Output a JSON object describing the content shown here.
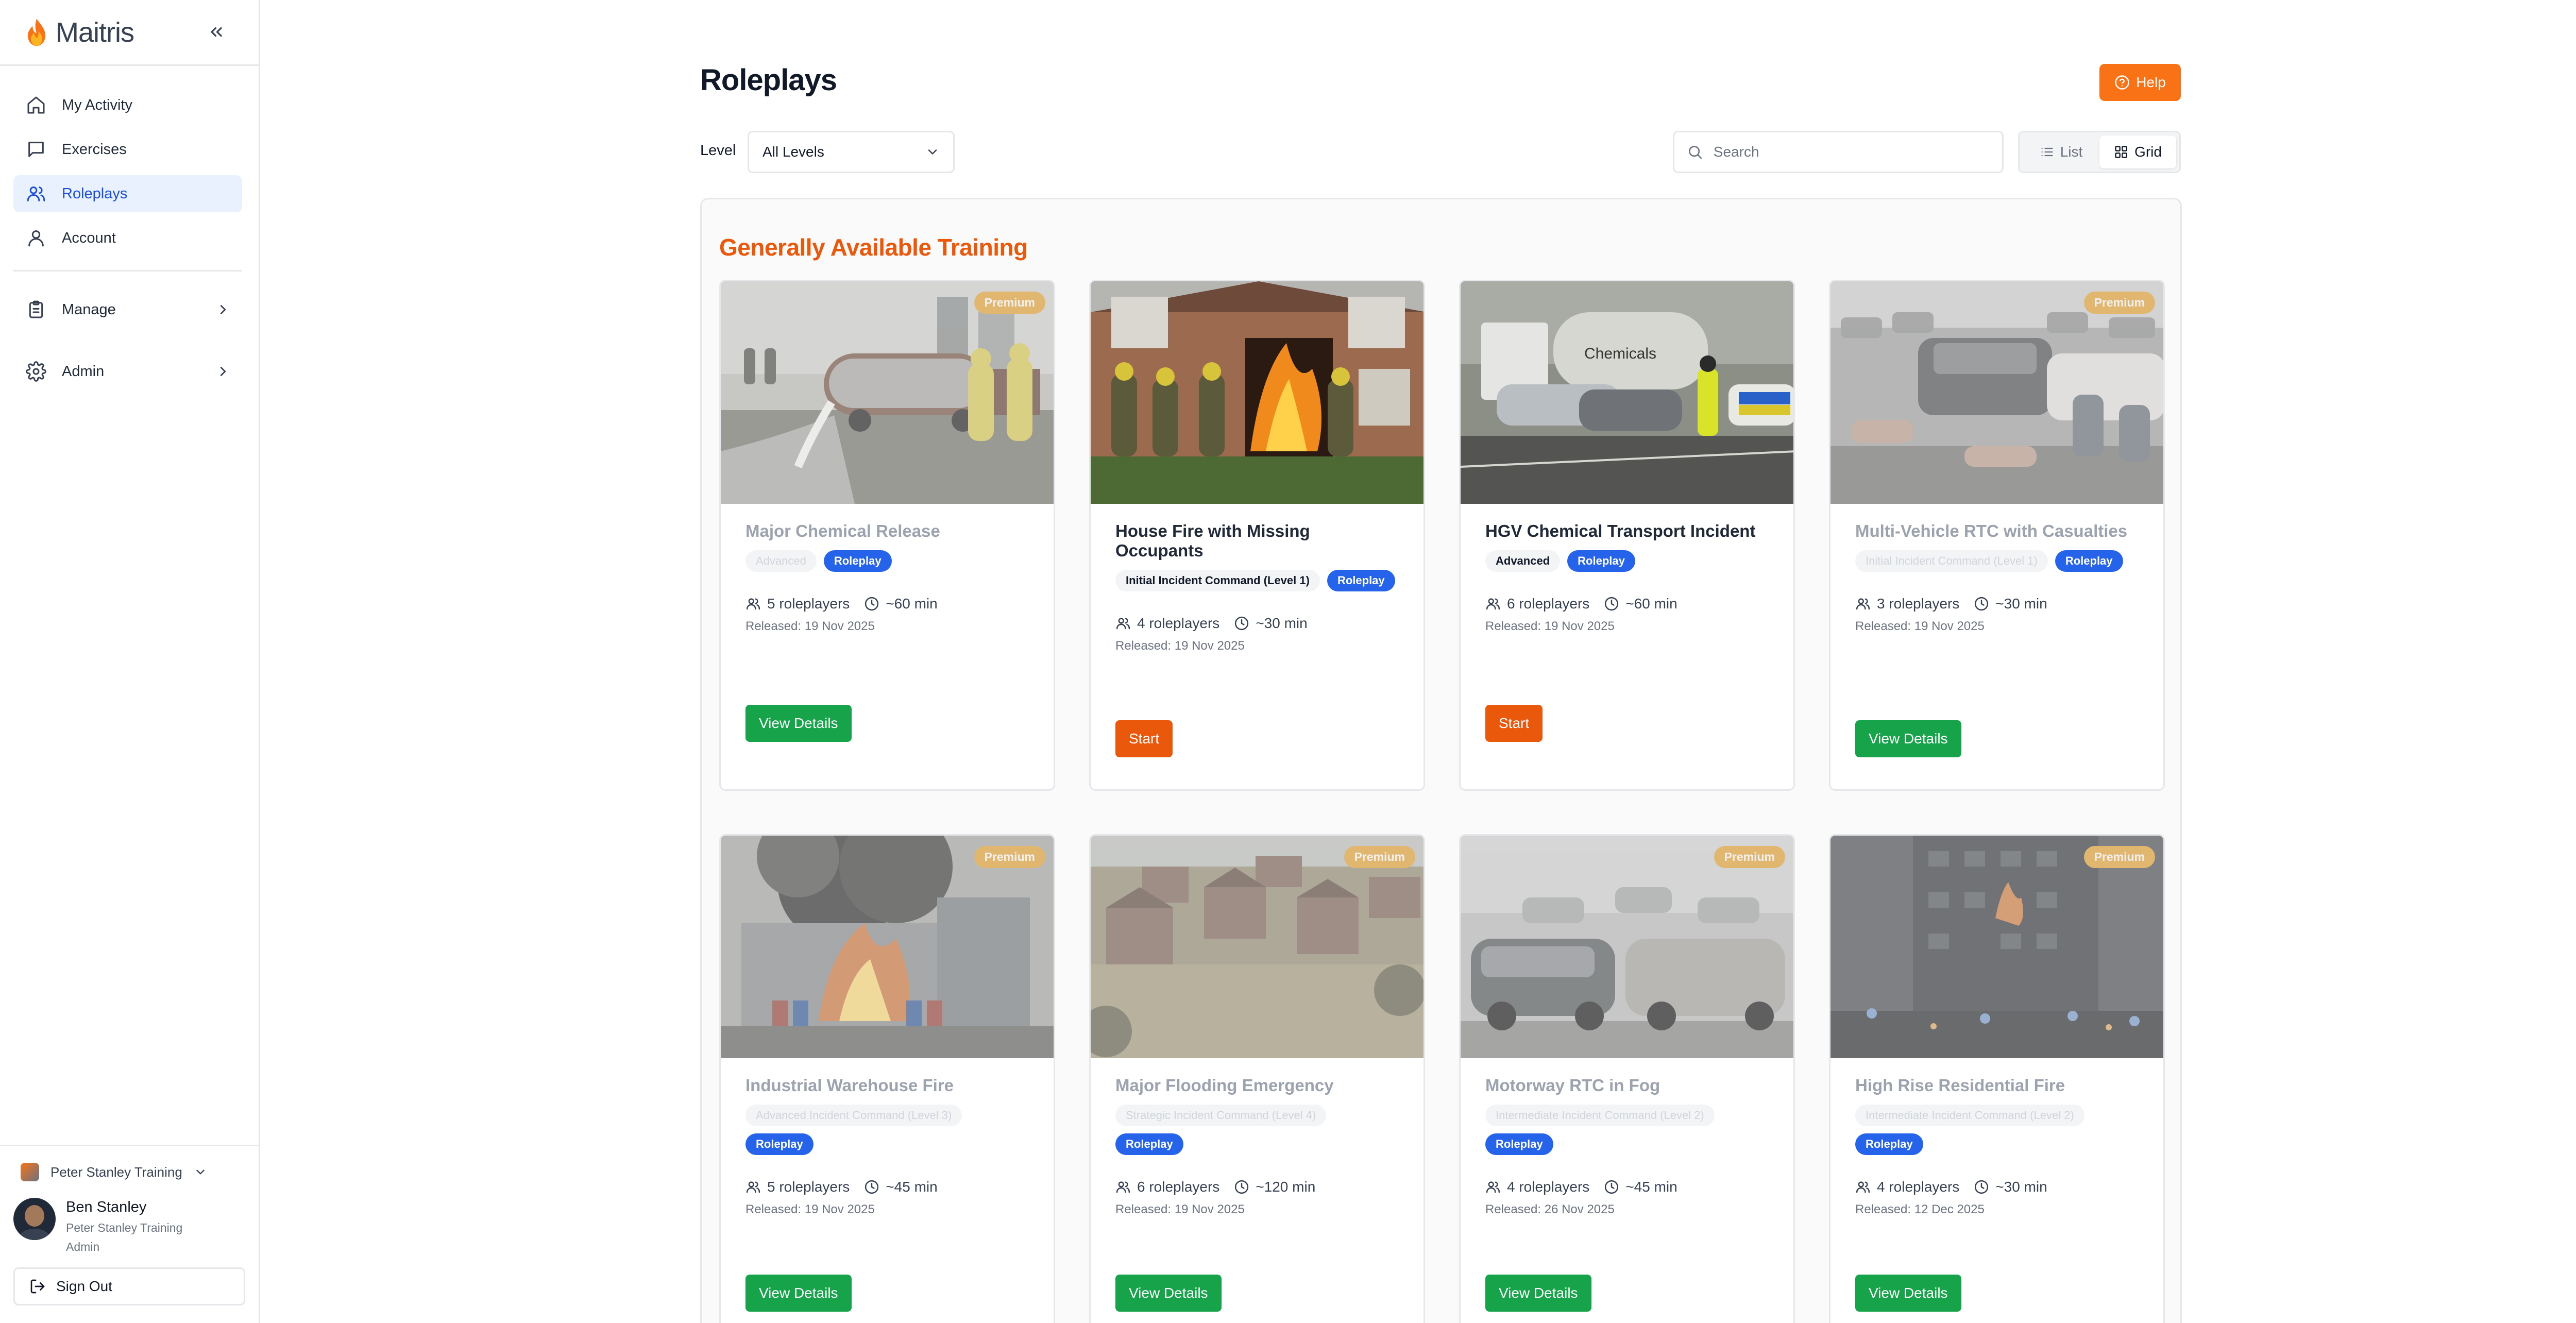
{
  "brand": {
    "name": "Maitris"
  },
  "sidebar": {
    "items": [
      {
        "label": "My Activity",
        "icon": "home-icon"
      },
      {
        "label": "Exercises",
        "icon": "chat-icon"
      },
      {
        "label": "Roleplays",
        "icon": "users-icon",
        "active": true
      },
      {
        "label": "Account",
        "icon": "user-icon"
      }
    ],
    "groups": [
      {
        "label": "Manage",
        "icon": "clipboard-icon"
      },
      {
        "label": "Admin",
        "icon": "gear-icon"
      }
    ],
    "org": "Peter Stanley Training",
    "user": {
      "name": "Ben Stanley",
      "org": "Peter Stanley Training",
      "role": "Admin"
    },
    "sign_out": "Sign Out"
  },
  "page": {
    "title": "Roleplays",
    "help": "Help",
    "level_label": "Level",
    "level_value": "All Levels",
    "search_placeholder": "Search",
    "view_list": "List",
    "view_grid": "Grid",
    "section_title": "Generally Available Training"
  },
  "cards": [
    {
      "title": "Major Chemical Release",
      "premium": "Premium",
      "level": "Advanced",
      "type": "Roleplay",
      "roleplayers": "5 roleplayers",
      "duration": "~60 min",
      "released": "Released: 19 Nov 2025",
      "action": "View Details",
      "locked": true
    },
    {
      "title": "House Fire with Missing Occupants",
      "premium": "",
      "level": "Initial Incident Command (Level 1)",
      "type": "Roleplay",
      "roleplayers": "4 roleplayers",
      "duration": "~30 min",
      "released": "Released: 19 Nov 2025",
      "action": "Start",
      "locked": false
    },
    {
      "title": "HGV Chemical Transport Incident",
      "premium": "",
      "level": "Advanced",
      "type": "Roleplay",
      "roleplayers": "6 roleplayers",
      "duration": "~60 min",
      "released": "Released: 19 Nov 2025",
      "action": "Start",
      "locked": false
    },
    {
      "title": "Multi-Vehicle RTC with Casualties",
      "premium": "Premium",
      "level": "Initial Incident Command (Level 1)",
      "type": "Roleplay",
      "roleplayers": "3 roleplayers",
      "duration": "~30 min",
      "released": "Released: 19 Nov 2025",
      "action": "View Details",
      "locked": true
    },
    {
      "title": "Industrial Warehouse Fire",
      "premium": "Premium",
      "level": "Advanced Incident Command (Level 3)",
      "type": "Roleplay",
      "roleplayers": "5 roleplayers",
      "duration": "~45 min",
      "released": "Released: 19 Nov 2025",
      "action": "View Details",
      "locked": true
    },
    {
      "title": "Major Flooding Emergency",
      "premium": "Premium",
      "level": "Strategic Incident Command (Level 4)",
      "type": "Roleplay",
      "roleplayers": "6 roleplayers",
      "duration": "~120 min",
      "released": "Released: 19 Nov 2025",
      "action": "View Details",
      "locked": true
    },
    {
      "title": "Motorway RTC in Fog",
      "premium": "Premium",
      "level": "Intermediate Incident Command (Level 2)",
      "type": "Roleplay",
      "roleplayers": "4 roleplayers",
      "duration": "~45 min",
      "released": "Released: 26 Nov 2025",
      "action": "View Details",
      "locked": true
    },
    {
      "title": "High Rise Residential Fire",
      "premium": "Premium",
      "level": "Intermediate Incident Command (Level 2)",
      "type": "Roleplay",
      "roleplayers": "4 roleplayers",
      "duration": "~30 min",
      "released": "Released: 12 Dec 2025",
      "action": "View Details",
      "locked": true
    }
  ],
  "colors": {
    "accent": "#ea580c",
    "primary": "#2563eb",
    "success": "#16a34a",
    "premium": "#f59e0b"
  }
}
